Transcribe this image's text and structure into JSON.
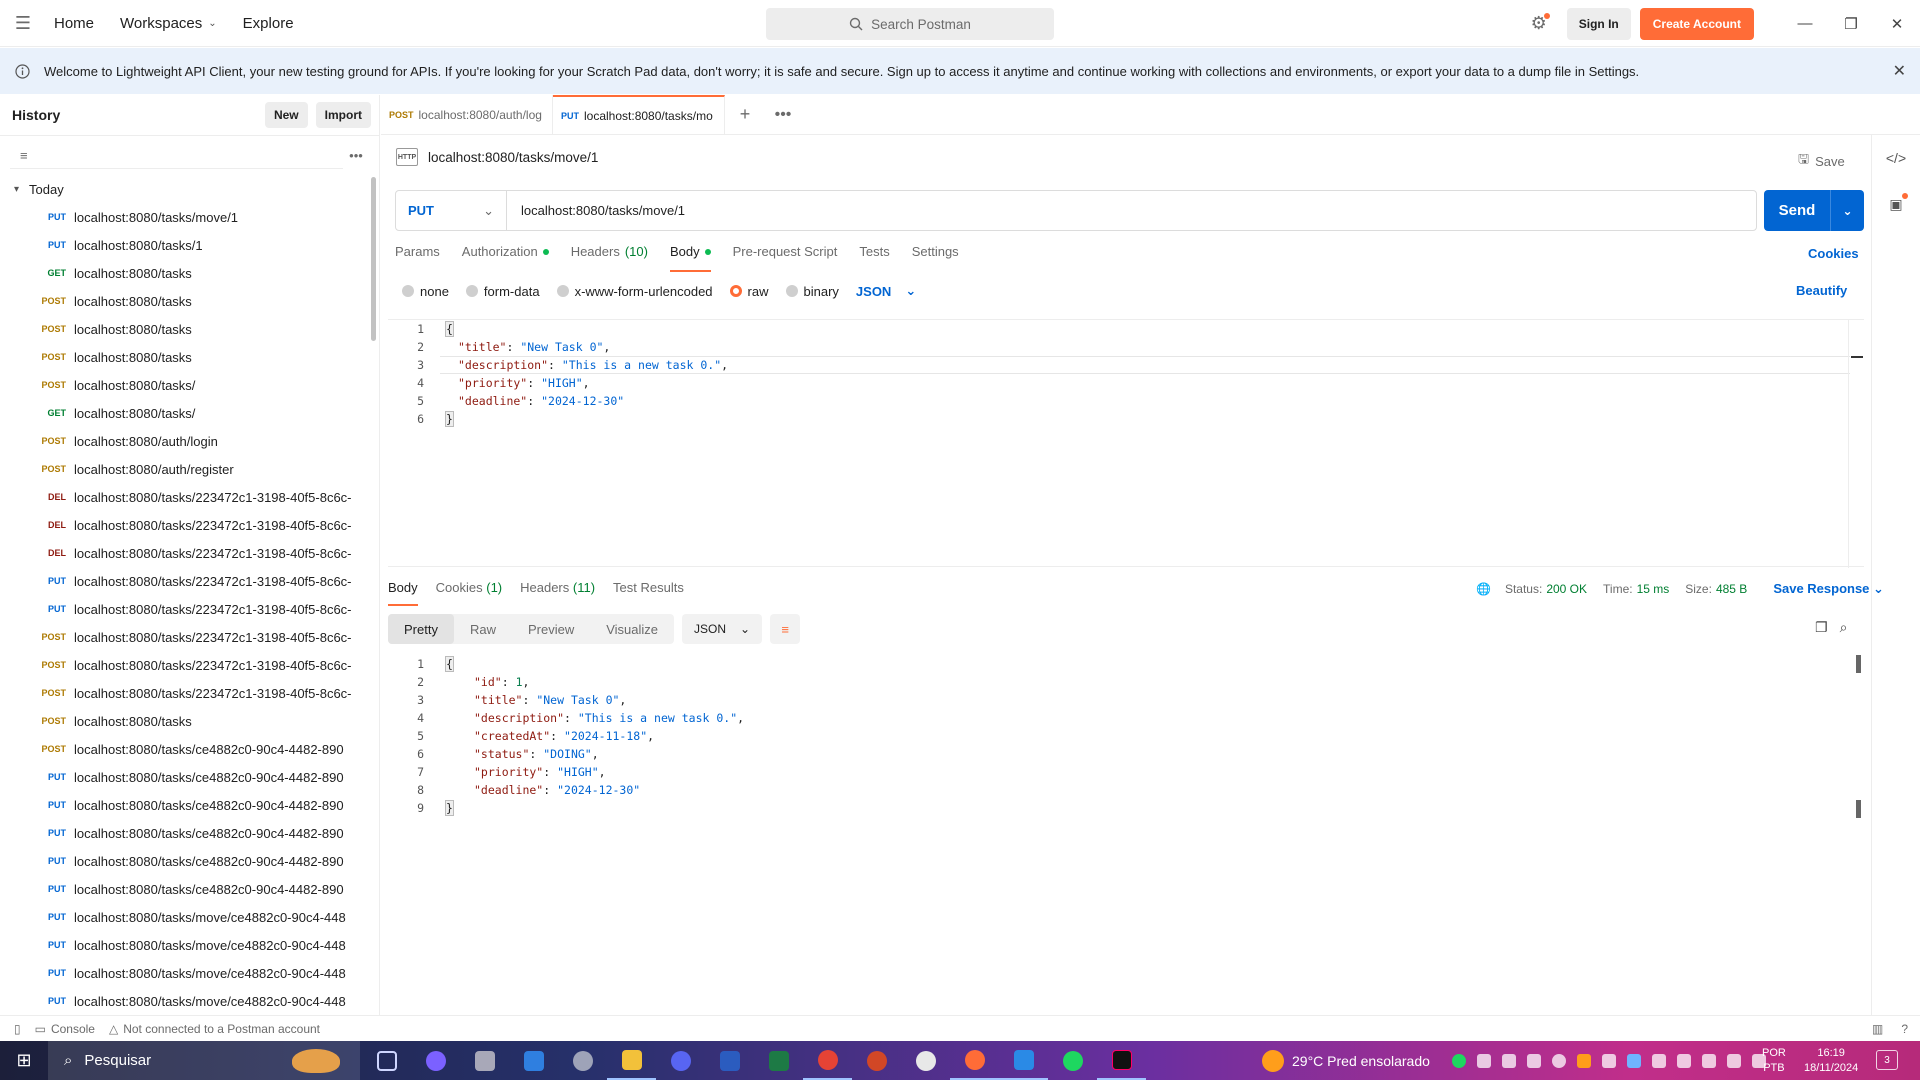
{
  "topbar": {
    "home": "Home",
    "workspaces": "Workspaces",
    "explore": "Explore",
    "search_placeholder": "Search Postman",
    "sign_in": "Sign In",
    "create_account": "Create Account"
  },
  "banner": {
    "text": "Welcome to Lightweight API Client, your new testing ground for APIs. If you're looking for your Scratch Pad data, don't worry; it is safe and secure. Sign up to access it anytime and continue working with collections and environments, or export your data to a dump file in Settings."
  },
  "sidebar": {
    "title": "History",
    "new_label": "New",
    "import_label": "Import",
    "group": "Today",
    "items": [
      {
        "method": "PUT",
        "url": "localhost:8080/tasks/move/1"
      },
      {
        "method": "PUT",
        "url": "localhost:8080/tasks/1"
      },
      {
        "method": "GET",
        "url": "localhost:8080/tasks"
      },
      {
        "method": "POST",
        "url": "localhost:8080/tasks"
      },
      {
        "method": "POST",
        "url": "localhost:8080/tasks"
      },
      {
        "method": "POST",
        "url": "localhost:8080/tasks"
      },
      {
        "method": "POST",
        "url": "localhost:8080/tasks/"
      },
      {
        "method": "GET",
        "url": "localhost:8080/tasks/"
      },
      {
        "method": "POST",
        "url": "localhost:8080/auth/login"
      },
      {
        "method": "POST",
        "url": "localhost:8080/auth/register"
      },
      {
        "method": "DEL",
        "url": "localhost:8080/tasks/223472c1-3198-40f5-8c6c-"
      },
      {
        "method": "DEL",
        "url": "localhost:8080/tasks/223472c1-3198-40f5-8c6c-"
      },
      {
        "method": "DEL",
        "url": "localhost:8080/tasks/223472c1-3198-40f5-8c6c-"
      },
      {
        "method": "PUT",
        "url": "localhost:8080/tasks/223472c1-3198-40f5-8c6c-"
      },
      {
        "method": "PUT",
        "url": "localhost:8080/tasks/223472c1-3198-40f5-8c6c-"
      },
      {
        "method": "POST",
        "url": "localhost:8080/tasks/223472c1-3198-40f5-8c6c-"
      },
      {
        "method": "POST",
        "url": "localhost:8080/tasks/223472c1-3198-40f5-8c6c-"
      },
      {
        "method": "POST",
        "url": "localhost:8080/tasks/223472c1-3198-40f5-8c6c-"
      },
      {
        "method": "POST",
        "url": "localhost:8080/tasks"
      },
      {
        "method": "POST",
        "url": "localhost:8080/tasks/ce4882c0-90c4-4482-890"
      },
      {
        "method": "PUT",
        "url": "localhost:8080/tasks/ce4882c0-90c4-4482-890"
      },
      {
        "method": "PUT",
        "url": "localhost:8080/tasks/ce4882c0-90c4-4482-890"
      },
      {
        "method": "PUT",
        "url": "localhost:8080/tasks/ce4882c0-90c4-4482-890"
      },
      {
        "method": "PUT",
        "url": "localhost:8080/tasks/ce4882c0-90c4-4482-890"
      },
      {
        "method": "PUT",
        "url": "localhost:8080/tasks/ce4882c0-90c4-4482-890"
      },
      {
        "method": "PUT",
        "url": "localhost:8080/tasks/move/ce4882c0-90c4-448"
      },
      {
        "method": "PUT",
        "url": "localhost:8080/tasks/move/ce4882c0-90c4-448"
      },
      {
        "method": "PUT",
        "url": "localhost:8080/tasks/move/ce4882c0-90c4-448"
      },
      {
        "method": "PUT",
        "url": "localhost:8080/tasks/move/ce4882c0-90c4-448"
      }
    ]
  },
  "tabs": [
    {
      "method": "POST",
      "label": "localhost:8080/auth/log"
    },
    {
      "method": "PUT",
      "label": "localhost:8080/tasks/mo"
    }
  ],
  "request": {
    "title": "localhost:8080/tasks/move/1",
    "save_label": "Save",
    "method": "PUT",
    "url": "localhost:8080/tasks/move/1",
    "send_label": "Send",
    "subtabs": {
      "params": "Params",
      "authorization": "Authorization",
      "headers": "Headers",
      "headers_count": "(10)",
      "body": "Body",
      "prerequest": "Pre-request Script",
      "tests": "Tests",
      "settings": "Settings"
    },
    "cookies_label": "Cookies",
    "body_types": [
      "none",
      "form-data",
      "x-www-form-urlencoded",
      "raw",
      "binary"
    ],
    "format": "JSON",
    "beautify_label": "Beautify",
    "body_lines": [
      {
        "n": "1",
        "k": "",
        "v": "",
        "vt": "",
        "punct": "{"
      },
      {
        "n": "2",
        "k": "\"title\"",
        "v": "\"New Task 0\"",
        "vt": "s",
        "punct": ","
      },
      {
        "n": "3",
        "k": "\"description\"",
        "v": "\"This is a new task 0.\"",
        "vt": "s",
        "punct": ","
      },
      {
        "n": "4",
        "k": "\"priority\"",
        "v": "\"HIGH\"",
        "vt": "s",
        "punct": ","
      },
      {
        "n": "5",
        "k": "\"deadline\"",
        "v": "\"2024-12-30\"",
        "vt": "s",
        "punct": ""
      },
      {
        "n": "6",
        "k": "",
        "v": "",
        "vt": "",
        "punct": "}"
      }
    ]
  },
  "response": {
    "tabs": {
      "body": "Body",
      "cookies": "Cookies",
      "cookies_count": "(1)",
      "headers": "Headers",
      "headers_count": "(11)",
      "tests": "Test Results"
    },
    "status_label": "Status:",
    "status": "200 OK",
    "time_label": "Time:",
    "time": "15 ms",
    "size_label": "Size:",
    "size": "485 B",
    "save_response": "Save Response",
    "views": [
      "Pretty",
      "Raw",
      "Preview",
      "Visualize"
    ],
    "format": "JSON",
    "body_lines": [
      {
        "n": "1",
        "k": "",
        "v": "",
        "vt": "",
        "punct": "{"
      },
      {
        "n": "2",
        "k": "\"id\"",
        "v": "1",
        "vt": "n",
        "punct": ","
      },
      {
        "n": "3",
        "k": "\"title\"",
        "v": "\"New Task 0\"",
        "vt": "s",
        "punct": ","
      },
      {
        "n": "4",
        "k": "\"description\"",
        "v": "\"This is a new task 0.\"",
        "vt": "s",
        "punct": ","
      },
      {
        "n": "5",
        "k": "\"createdAt\"",
        "v": "\"2024-11-18\"",
        "vt": "s",
        "punct": ","
      },
      {
        "n": "6",
        "k": "\"status\"",
        "v": "\"DOING\"",
        "vt": "s",
        "punct": ","
      },
      {
        "n": "7",
        "k": "\"priority\"",
        "v": "\"HIGH\"",
        "vt": "s",
        "punct": ","
      },
      {
        "n": "8",
        "k": "\"deadline\"",
        "v": "\"2024-12-30\"",
        "vt": "s",
        "punct": ""
      },
      {
        "n": "9",
        "k": "",
        "v": "",
        "vt": "",
        "punct": "}"
      }
    ]
  },
  "statusbar": {
    "console": "Console",
    "account": "Not connected to a Postman account"
  },
  "taskbar": {
    "search": "Pesquisar",
    "weather": "29°C  Pred ensolarado",
    "lang1": "POR",
    "lang2": "PTB",
    "time": "16:19",
    "date": "18/11/2024",
    "notifications": "3"
  },
  "colors": {
    "accent": "#ff6c37",
    "link": "#0265d2",
    "put": "#0265d2",
    "get": "#007f31",
    "post": "#ad7a03",
    "del": "#8e1a10"
  }
}
